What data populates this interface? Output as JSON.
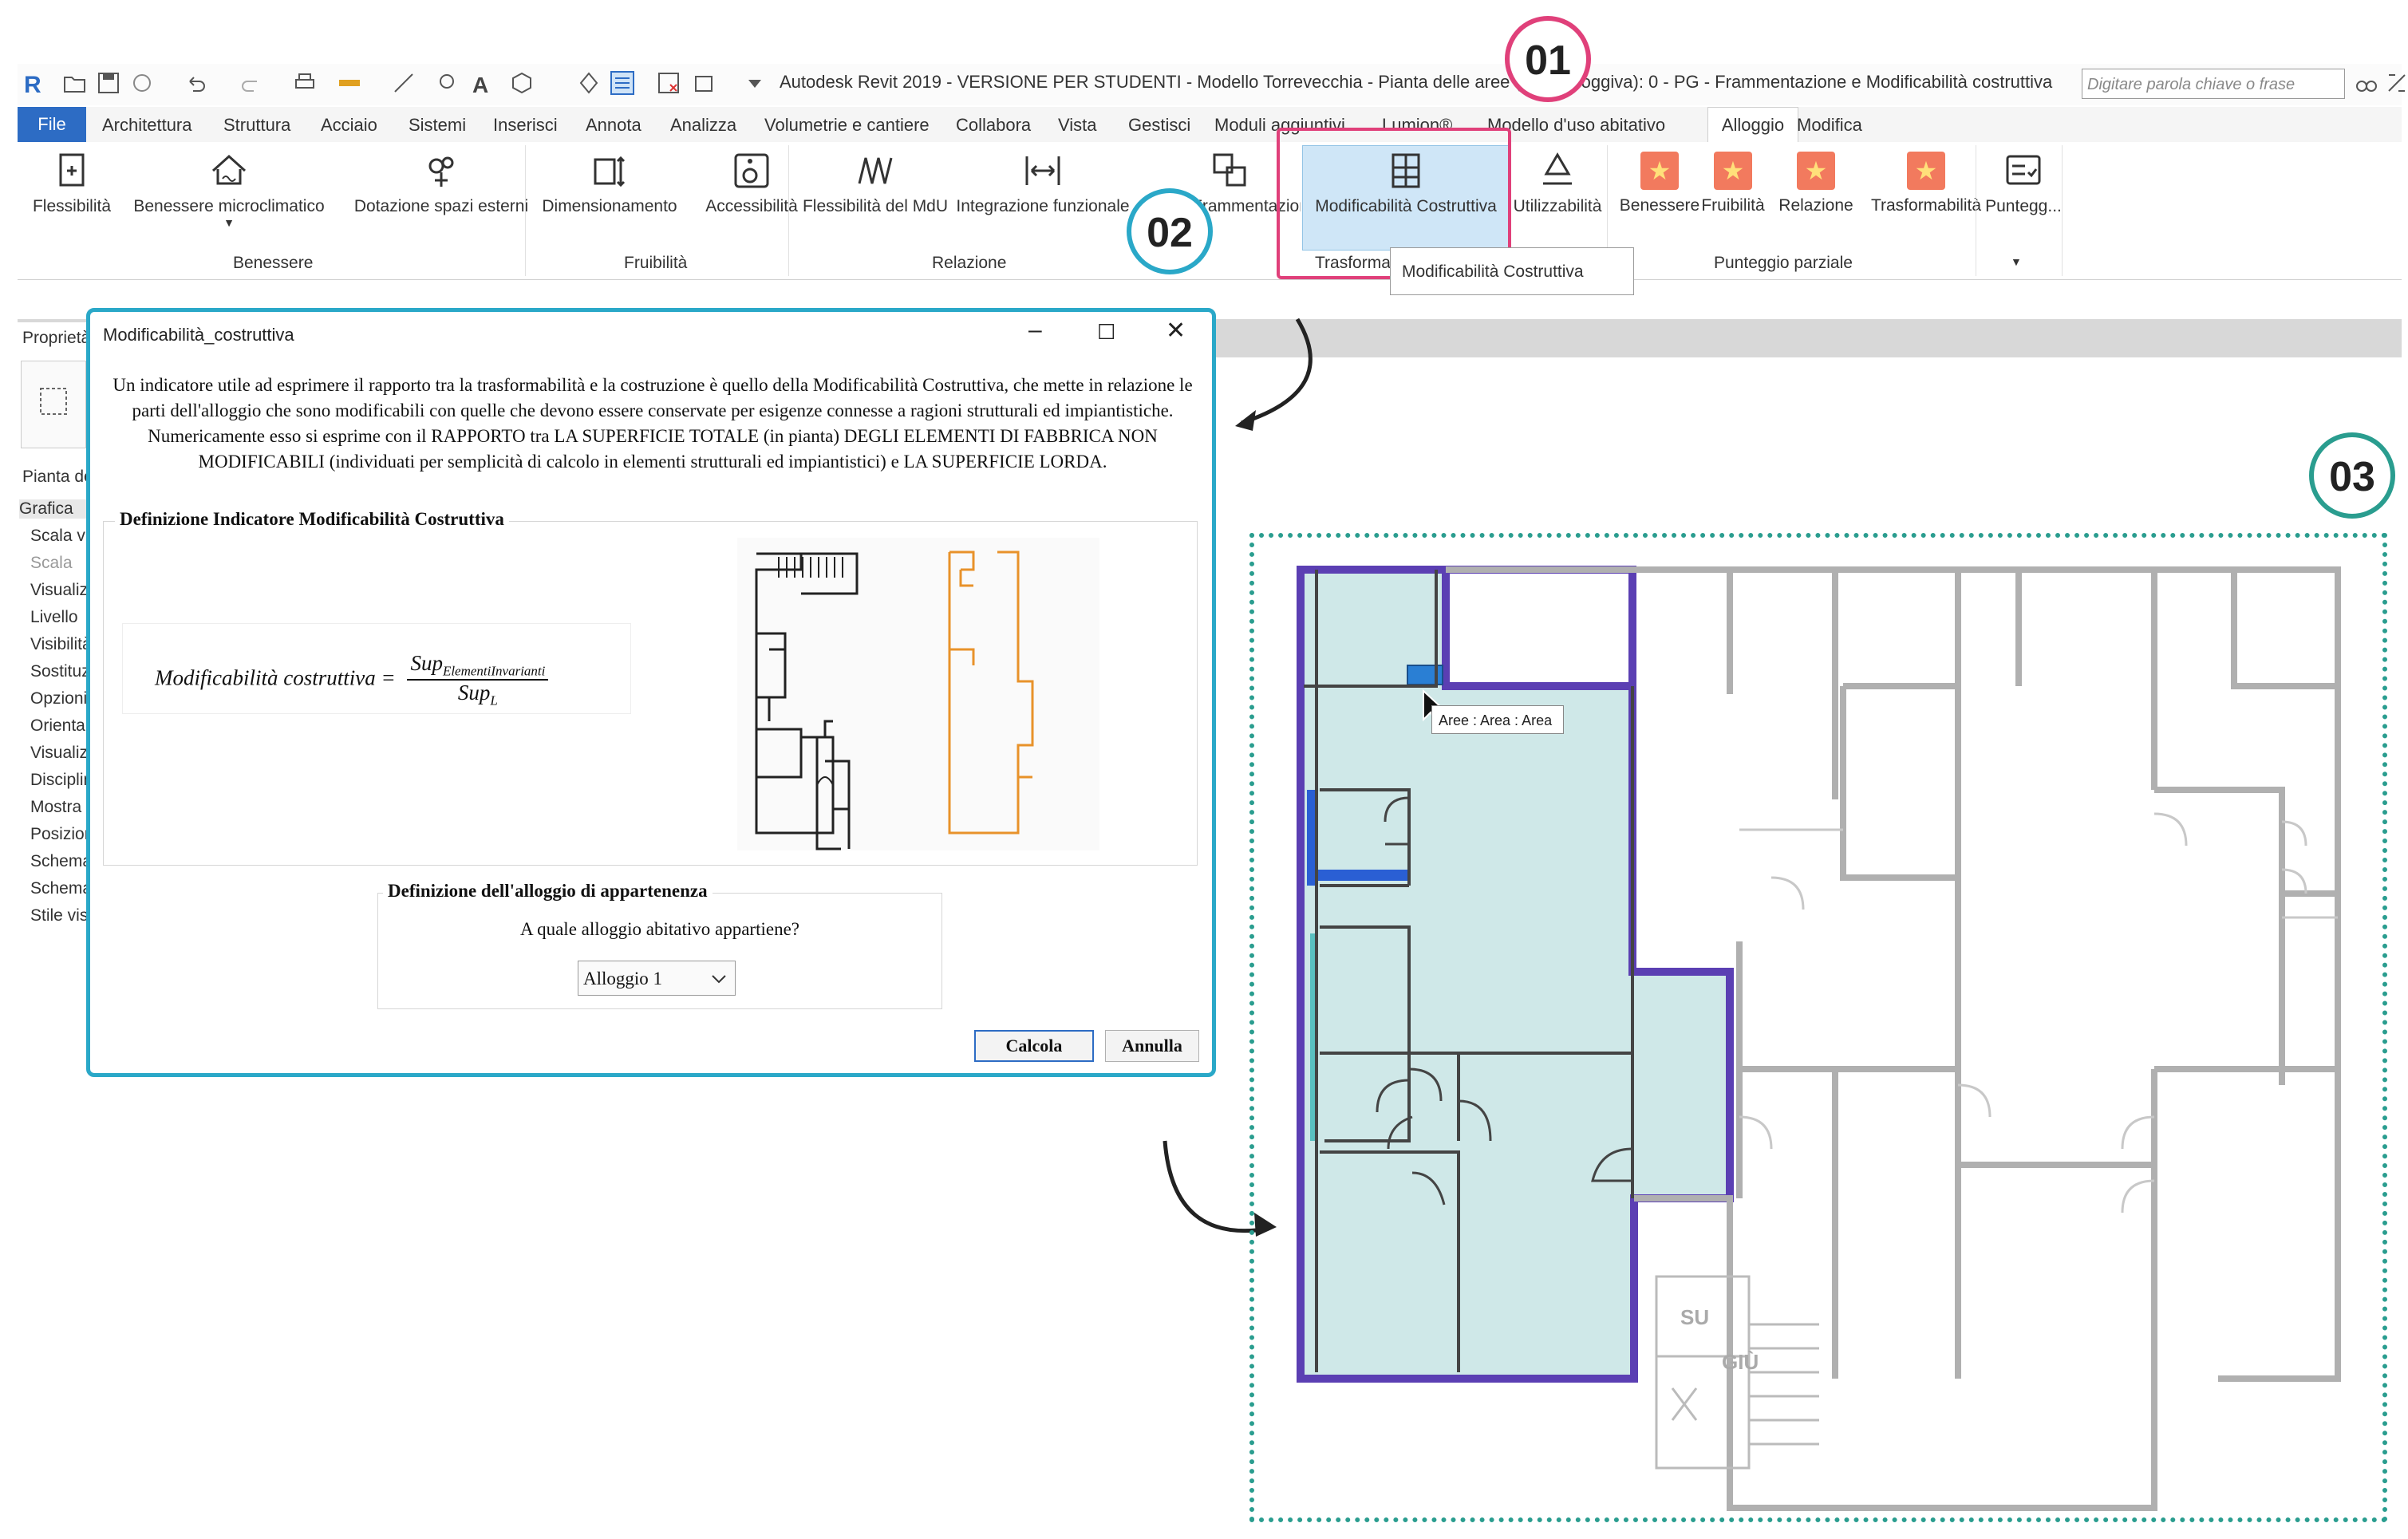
{
  "titlebar": {
    "title": "Autodesk Revit 2019 - VERSIONE PER STUDENTI - Modello Torrevecchia - Pianta delle aree (Area Alloggiva): 0 - PG - Frammentazione e Modificabilità costruttiva",
    "search_placeholder": "Digitare parola chiave o frase"
  },
  "menubar": {
    "file": "File",
    "tabs": [
      "Architettura",
      "Struttura",
      "Acciaio",
      "Sistemi",
      "Inserisci",
      "Annota",
      "Analizza",
      "Volumetrie e cantiere",
      "Collabora",
      "Vista",
      "Gestisci",
      "Moduli aggiuntivi",
      "Lumion®",
      "Modello d'uso abitativo"
    ],
    "active": "Alloggio",
    "after": "Modifica"
  },
  "ribbon": {
    "buttons": {
      "flessibilita": "Flessibilità",
      "benessere_micro": "Benessere microclimatico",
      "dotazione": "Dotazione spazi esterni",
      "dimensionamento": "Dimensionamento",
      "accessibilita": "Accessibilità",
      "flessibilita_mdu": "Flessibilità del MdU",
      "integrazione": "Integrazione funzionale",
      "frammentazione": "Frammentazione",
      "modificabilita": "Modificabilità Costruttiva",
      "utilizzabilita": "Utilizzabilità",
      "benessere": "Benessere",
      "fruibilita": "Fruibilità",
      "relazione": "Relazione",
      "trasformabilita": "Trasformabilità",
      "punteggio": "Puntegg..."
    },
    "panels": {
      "benessere": "Benessere",
      "fruibilita": "Fruibilità",
      "relazione": "Relazione",
      "trasformabilita": "Trasformabilità",
      "punteggio_parziale": "Punteggio parziale"
    },
    "tooltip": "Modificabilità Costruttiva"
  },
  "properties": {
    "title": "Proprietà",
    "type": "Pianta delle aree",
    "rows": [
      "Grafica",
      "Scala vista",
      "Scala",
      "Visualizza",
      "Livello",
      "Visibilità",
      "Sostituzioni",
      "Opzioni",
      "Orientamento",
      "Visualizza",
      "Disciplina",
      "Mostra",
      "Posizione",
      "Schema",
      "Schema",
      "Stile vis"
    ]
  },
  "dialog": {
    "title": "Modificabilità_costruttiva",
    "controls": {
      "minimize": "–",
      "maximize": "☐",
      "close": "✕"
    },
    "intro": "Un indicatore utile ad esprimere il rapporto tra la trasformabilità e la costruzione è quello della Modificabilità Costruttiva, che mette in relazione le parti dell'alloggio che sono modificabili con quelle che devono essere conservate per esigenze connesse a ragioni strutturali ed impiantistiche. Numericamente esso si esprime con il RAPPORTO tra LA SUPERFICIE TOTALE (in pianta) DEGLI ELEMENTI DI FABBRICA NON MODIFICABILI (individuati per semplicità di calcolo in elementi strutturali ed impiantistici) e LA SUPERFICIE LORDA.",
    "group1_title": "Definizione Indicatore Modificabilità Costruttiva",
    "formula": {
      "lhs": "Modificabilità costruttiva =",
      "num": "Sup",
      "num_sub": "ElementiInvarianti",
      "den": "Sup",
      "den_sub": "L"
    },
    "group2_title": "Definizione dell'alloggio di appartenenza",
    "question": "A quale alloggio abitativo appartiene?",
    "select_value": "Alloggio 1",
    "calcola": "Calcola",
    "annulla": "Annulla"
  },
  "badges": {
    "b1": "01",
    "b2": "02",
    "b3": "03"
  },
  "plan": {
    "area_tag": "Aree : Area : Area",
    "stair_up": "SU",
    "stair_down": "GIÙ"
  },
  "colors": {
    "accent_blue": "#2d6cc4",
    "badge01": "#e0407a",
    "badge02": "#2aa8c8",
    "badge03": "#2a9d8f",
    "area_fill": "#cfe8e8",
    "area_border": "#5b3fb3"
  }
}
